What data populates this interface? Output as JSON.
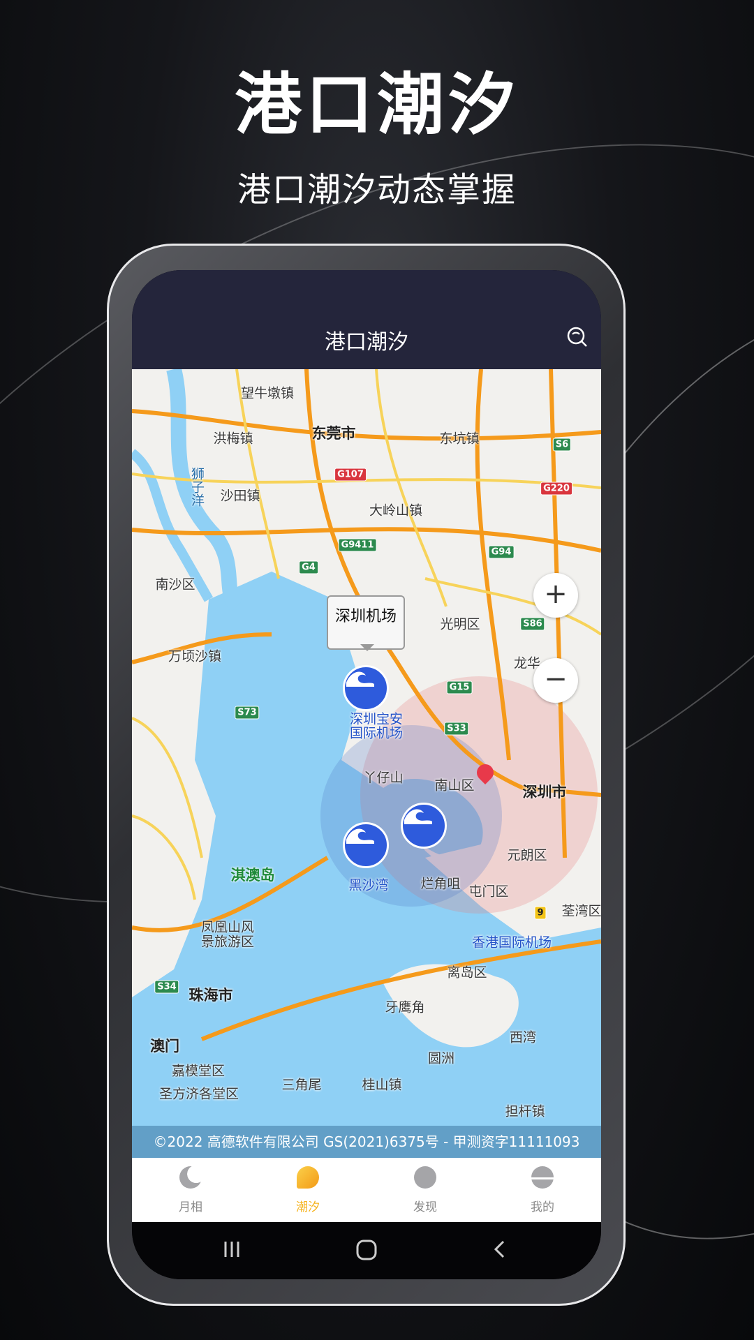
{
  "hero": {
    "title": "港口潮汐",
    "subtitle": "港口潮汐动态掌握"
  },
  "app": {
    "title": "港口潮汐",
    "search_icon": "search-icon"
  },
  "map": {
    "labels": [
      "望牛墩镇",
      "东莞市",
      "洪梅镇",
      "东坑镇",
      "沙田镇",
      "大岭山镇",
      "南沙区",
      "光明区",
      "万顷沙镇",
      "龙华",
      "深圳宝安",
      "国际机场",
      "丫仔山",
      "南山区",
      "深圳市",
      "黑沙湾",
      "烂角咀",
      "元朗区",
      "屯门区",
      "淇澳岛",
      "凤凰山风",
      "景旅游区",
      "荃湾区",
      "香港国际机场",
      "离岛区",
      "珠海市",
      "牙鹰角",
      "澳门",
      "西湾",
      "嘉模堂区",
      "圆洲",
      "三角尾",
      "桂山镇",
      "圣方济各堂区",
      "担杆镇",
      "狮子洋"
    ],
    "road_badges": [
      "G107",
      "S6",
      "G220",
      "G9411",
      "G94",
      "G4",
      "S86",
      "G15",
      "S33",
      "S73",
      "S34",
      "9"
    ],
    "popup": "深圳机场",
    "zoom_in": "+",
    "zoom_out": "−",
    "copyright": "©2022 高德软件有限公司 GS(2021)6375号 - 甲测资字11111093",
    "colors": {
      "water": "#8fd0f5",
      "land": "#f2f1ee",
      "highway": "#f59a1b",
      "road": "#f7d35a",
      "marker": "#2e5bdc",
      "pin": "#e8394a"
    }
  },
  "tabs": [
    {
      "label": "月相",
      "icon": "moon-icon"
    },
    {
      "label": "潮汐",
      "icon": "wave-icon",
      "active": true
    },
    {
      "label": "发现",
      "icon": "planet-icon"
    },
    {
      "label": "我的",
      "icon": "profile-icon"
    }
  ],
  "accent": "#f5b31c"
}
